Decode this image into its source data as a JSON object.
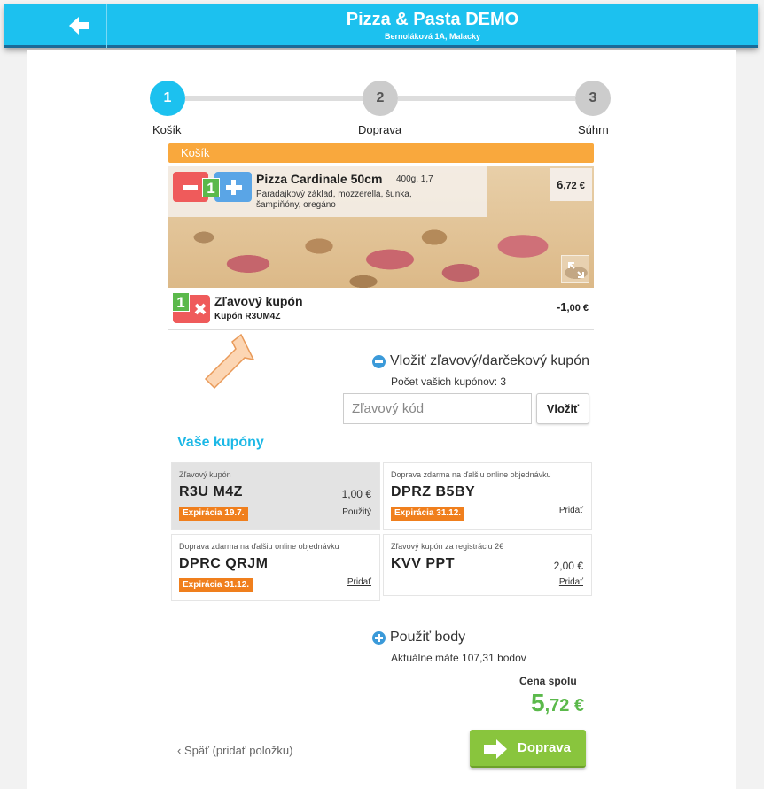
{
  "header": {
    "title": "Pizza & Pasta DEMO",
    "subtitle": "Bernoláková 1A, Malacky",
    "back_icon": "arrow-left-icon"
  },
  "steps": [
    {
      "number": "1",
      "label": "Košík",
      "active": true
    },
    {
      "number": "2",
      "label": "Doprava",
      "active": false
    },
    {
      "number": "3",
      "label": "Súhrn",
      "active": false
    }
  ],
  "cart": {
    "header": "Košík",
    "items": [
      {
        "quantity": "1",
        "name": "Pizza Cardinale 50cm",
        "meta": "400g, 1,7",
        "description": "Paradajkový základ, mozzerella, šunka, šampiňóny, oregáno",
        "price_int": "6",
        "price_rest": ",72 €"
      }
    ],
    "coupon": {
      "quantity": "1",
      "name": "Zľavový kupón",
      "code": "Kupón R3UM4Z",
      "price_int": "-1",
      "price_rest": ",00 €"
    }
  },
  "coupon_form": {
    "title": "Vložiť zľavový/darčekový kupón",
    "count_text": "Počet vašich kupónov: 3",
    "placeholder": "Zľavový kód",
    "apply_label": "Vložiť"
  },
  "your_coupons": {
    "title": "Vaše kupóny",
    "items": [
      {
        "type": "Zľavový kupón",
        "code": "R3U M4Z",
        "value": "1,00 €",
        "expiry": "Expirácia 19.7.",
        "action": "Použitý",
        "used": true
      },
      {
        "type": "Doprava zdarma na ďalšiu online objednávku",
        "code": "DPRZ B5BY",
        "value": "",
        "expiry": "Expirácia 31.12.",
        "action": "Pridať",
        "used": false
      },
      {
        "type": "Doprava zdarma na ďalšiu online objednávku",
        "code": "DPRC QRJM",
        "value": "",
        "expiry": "Expirácia 31.12.",
        "action": "Pridať",
        "used": false
      },
      {
        "type": "Zľavový kupón za registráciu 2€",
        "code": "KVV PPT",
        "value": "2,00 €",
        "expiry": "",
        "action": "Pridať",
        "used": false
      }
    ]
  },
  "points": {
    "title": "Použiť body",
    "text": "Aktuálne máte 107,31 bodov"
  },
  "total": {
    "label": "Cena spolu",
    "int": "5",
    "rest": ",72 €"
  },
  "footer": {
    "back_label": "Späť (pridať položku)",
    "next_label": "Doprava"
  },
  "colors": {
    "header_bg": "#1cc1ef",
    "orange": "#f9a83d",
    "green": "#5bb94b",
    "red": "#ef5b5b",
    "blue": "#5aa5e6"
  }
}
